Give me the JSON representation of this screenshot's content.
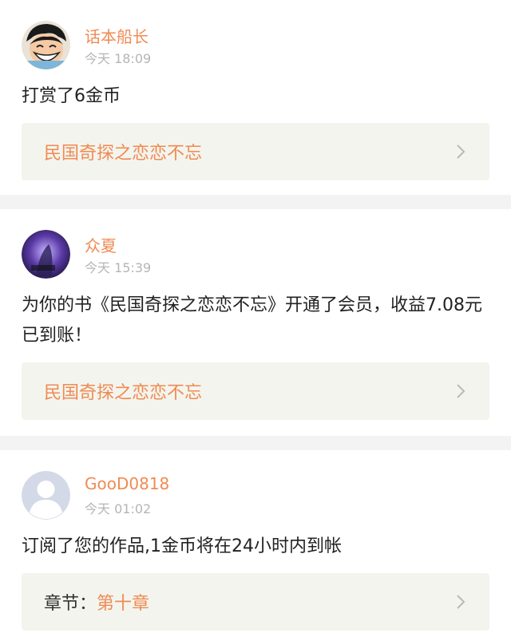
{
  "notifications": [
    {
      "username": "话本船长",
      "time": "今天 18:09",
      "message": "打赏了6金币",
      "link_prefix": "",
      "link_title": "民国奇探之恋恋不忘",
      "avatar_icon": "cartoon-pirate-avatar"
    },
    {
      "username": "众夏",
      "time": "今天 15:39",
      "message": "为你的书《民国奇探之恋恋不忘》开通了会员，收益7.08元已到账！",
      "link_prefix": "",
      "link_title": "民国奇探之恋恋不忘",
      "avatar_icon": "purple-photo-avatar"
    },
    {
      "username": "GooD0818",
      "time": "今天 01:02",
      "message": "订阅了您的作品,1金币将在24小时内到帐",
      "link_prefix": "章节：",
      "link_title": "第十章",
      "avatar_icon": "default-user-avatar"
    }
  ],
  "colors": {
    "accent": "#ef8b53",
    "box_bg": "#f4f4ee",
    "separator": "#f3f3f3",
    "time_gray": "#b5b5b5"
  },
  "icons": {
    "chevron": "chevron-right-icon"
  }
}
